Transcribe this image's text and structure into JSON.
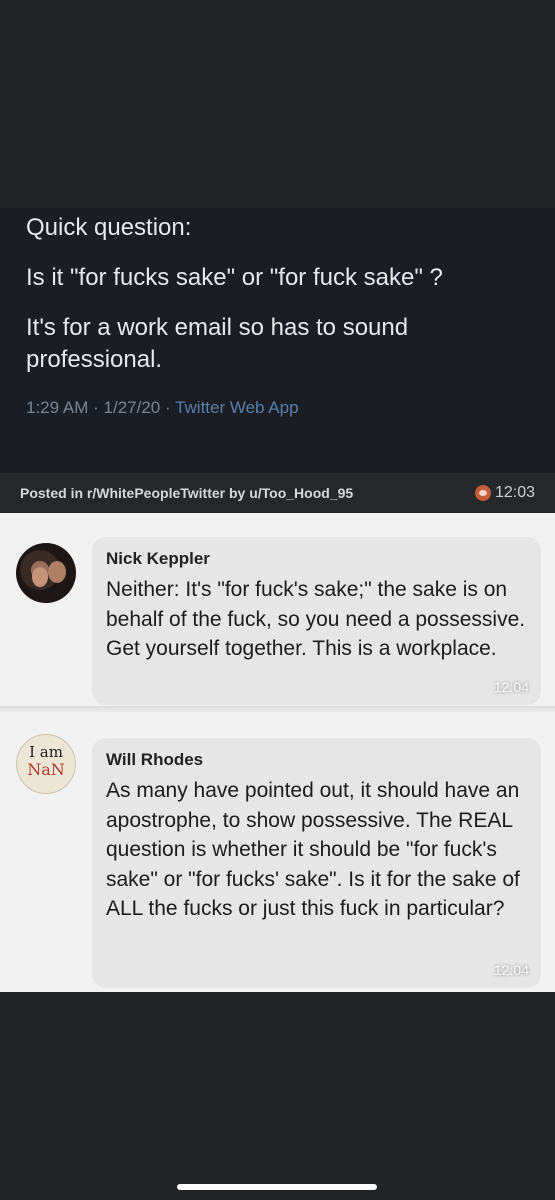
{
  "tweet": {
    "lines": [
      "Quick question:",
      "Is it \"for fucks sake\" or \"for fuck sake\" ?",
      "It's for a work email so has to sound professional."
    ],
    "time": "1:29 AM",
    "date": "1/27/20",
    "app": "Twitter Web App",
    "separator": "·"
  },
  "posted": {
    "text": "Posted in r/WhitePeopleTwitter by u/Too_Hood_95",
    "time": "12:03"
  },
  "messages": [
    {
      "name": "Nick Keppler",
      "text": "Neither: It's \"for fuck's sake;\" the sake is on behalf of the fuck, so you need a possessive. Get yourself together. This is a workplace.",
      "time": "12:04"
    },
    {
      "name": "Will Rhodes",
      "text": "As many have pointed out, it should have an apostrophe, to show possessive. The REAL question is whether it should be \"for fuck's sake\" or \"for fucks' sake\". Is it for the sake of ALL the fucks or just this fuck in particular?",
      "time": "12:04",
      "avatar_line1": "I am",
      "avatar_line2": "NaN"
    }
  ],
  "colors": {
    "background": "#232425",
    "tweet_bg": "#1a1d24",
    "bubble_bg": "#e6e6e6",
    "twitter_app_link": "#5b7fa8"
  }
}
